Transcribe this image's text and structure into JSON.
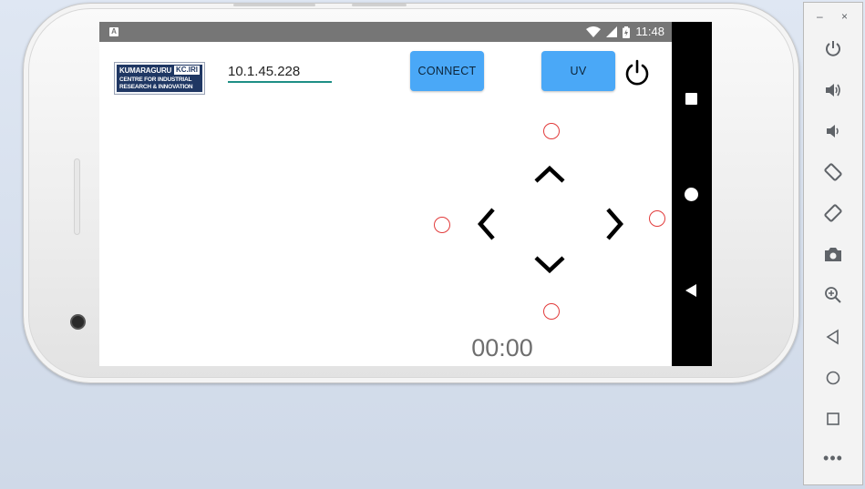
{
  "app": {
    "logo": {
      "line1": "KUMARAGURU",
      "tag": "KC.IRI",
      "line2": "CENTRE FOR INDUSTRIAL",
      "line3": "RESEARCH & INNOVATION"
    },
    "ip_value": "10.1.45.228",
    "connect_label": "CONNECT",
    "uv_label": "UV",
    "timer": "00:00",
    "accent_color": "#4aa8f7",
    "marker_color": "#e23b3b",
    "icons": {
      "power": "power-icon",
      "up": "chevron-up-icon",
      "down": "chevron-down-icon",
      "left": "chevron-left-icon",
      "right": "chevron-right-icon"
    }
  },
  "statusbar": {
    "notification_letter": "A",
    "time": "11:48"
  },
  "emulator_toolbar": {
    "minimize": "–",
    "close": "×",
    "more": "•••",
    "icons": [
      "power-icon",
      "volume-up-icon",
      "volume-down-icon",
      "rotate-left-icon",
      "rotate-right-icon",
      "camera-icon",
      "zoom-icon",
      "back-icon",
      "home-icon",
      "overview-icon",
      "more-icon"
    ]
  }
}
